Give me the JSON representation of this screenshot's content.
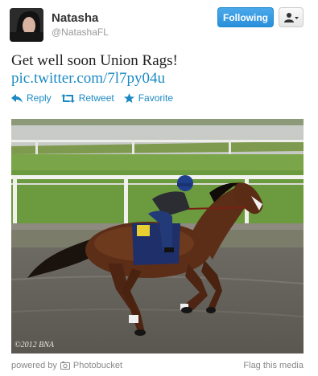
{
  "user": {
    "name": "Natasha",
    "handle": "@NatashaFL"
  },
  "header": {
    "follow_label": "Following"
  },
  "tweet": {
    "text": "Get well soon Union Rags!",
    "link": "pic.twitter.com/7l7py04u"
  },
  "actions": {
    "reply": "Reply",
    "retweet": "Retweet",
    "favorite": "Favorite"
  },
  "media": {
    "watermark": "©2012 BNA"
  },
  "footer": {
    "powered_by": "powered by",
    "provider": "Photobucket",
    "flag": "Flag this media"
  },
  "colors": {
    "link": "#1b8ac3",
    "follow_button": "#2a8fdb"
  }
}
